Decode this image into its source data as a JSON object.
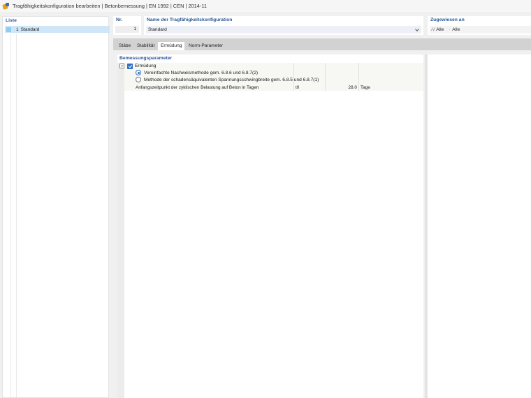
{
  "window": {
    "title": "Tragfähigkeitskonfiguration bearbeiten | Betonbemessung | EN 1992 | CEN | 2014-11",
    "icon": "app-icon"
  },
  "list": {
    "label": "Liste",
    "items": [
      {
        "number": "1",
        "name": "Standard",
        "selected": true,
        "color": "#8ccdf0"
      }
    ]
  },
  "header": {
    "nr_label": "Nr.",
    "nr_value": "1",
    "name_label": "Name der Tragfähigkeitskonfiguration",
    "name_value": "Standard",
    "assigned_label": "Zugewiesen an",
    "assigned_first": "Alle",
    "assigned_second": "Alle"
  },
  "tabs": [
    {
      "label": "Stäbe",
      "active": false
    },
    {
      "label": "Stabilität",
      "active": false
    },
    {
      "label": "Ermüdung",
      "active": true
    },
    {
      "label": "Norm-Parameter",
      "active": false
    }
  ],
  "params": {
    "section_label": "Bemessungsparameter",
    "group": {
      "label": "Ermüdung",
      "checked": true,
      "expanded": true
    },
    "options": [
      {
        "label": "Vereinfachte Nachweismethode gem. 6.8.6 und 6.8.7(2)",
        "selected": true
      },
      {
        "label": "Methode der schadensäquivalenten Spannungsschwingbreite gem. 6.8.5 und 6.8.7(1)",
        "selected": false
      }
    ],
    "row": {
      "label": "Anfangszeitpunkt der zyklischen Belastung auf Beton in Tagen",
      "symbol": "t0",
      "value": "28.0",
      "unit": "Tage"
    }
  },
  "colors": {
    "accent": "#2f6fc7",
    "label": "#2b5797",
    "selection": "#cfe6f8"
  }
}
